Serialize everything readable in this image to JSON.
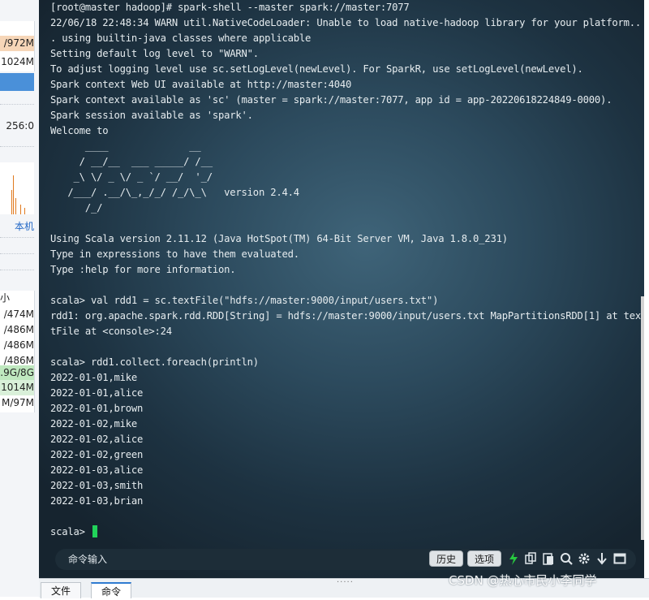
{
  "left_panel": {
    "rows": [
      "/972M",
      "1024M",
      "",
      "",
      "256:0"
    ],
    "host_label": "本机",
    "size_header": "小",
    "size_rows": [
      "/474M",
      "/486M",
      "/486M",
      "/486M",
      ".9G/8G",
      "1014M",
      "M/97M"
    ]
  },
  "terminal": {
    "lines": [
      "[root@master hadoop]# spark-shell --master spark://master:7077",
      "22/06/18 22:48:34 WARN util.NativeCodeLoader: Unable to load native-hadoop library for your platform..",
      ". using builtin-java classes where applicable",
      "Setting default log level to \"WARN\".",
      "To adjust logging level use sc.setLogLevel(newLevel). For SparkR, use setLogLevel(newLevel).",
      "Spark context Web UI available at http://master:4040",
      "Spark context available as 'sc' (master = spark://master:7077, app id = app-20220618224849-0000).",
      "Spark session available as 'spark'.",
      "Welcome to",
      "      ____              __",
      "     / __/__  ___ _____/ /__",
      "    _\\ \\/ _ \\/ _ `/ __/  '_/",
      "   /___/ .__/\\_,_/_/ /_/\\_\\   version 2.4.4",
      "      /_/",
      "",
      "Using Scala version 2.11.12 (Java HotSpot(TM) 64-Bit Server VM, Java 1.8.0_231)",
      "Type in expressions to have them evaluated.",
      "Type :help for more information.",
      "",
      "scala> val rdd1 = sc.textFile(\"hdfs://master:9000/input/users.txt\")",
      "rdd1: org.apache.spark.rdd.RDD[String] = hdfs://master:9000/input/users.txt MapPartitionsRDD[1] at tex",
      "tFile at <console>:24",
      "",
      "scala> rdd1.collect.foreach(println)",
      "2022-01-01,mike",
      "2022-01-01,alice",
      "2022-01-01,brown",
      "2022-01-02,mike",
      "2022-01-02,alice",
      "2022-01-02,green",
      "2022-01-03,alice",
      "2022-01-03,smith",
      "2022-01-03,brian",
      ""
    ],
    "prompt": "scala> "
  },
  "command_bar": {
    "placeholder": "命令输入",
    "history_label": "历史",
    "options_label": "选项",
    "icons": [
      "lightning-icon",
      "copy-icon",
      "paste-icon",
      "search-icon",
      "gear-icon",
      "download-icon",
      "maximize-icon"
    ]
  },
  "bottom_tabs": {
    "files_label": "文件",
    "commands_label": "命令"
  },
  "watermark": "CSDN @热心市民小李同学",
  "colors": {
    "terminal_text": "#e6ecef",
    "cursor": "#21d35a",
    "accent_blue": "#4a90d9"
  }
}
